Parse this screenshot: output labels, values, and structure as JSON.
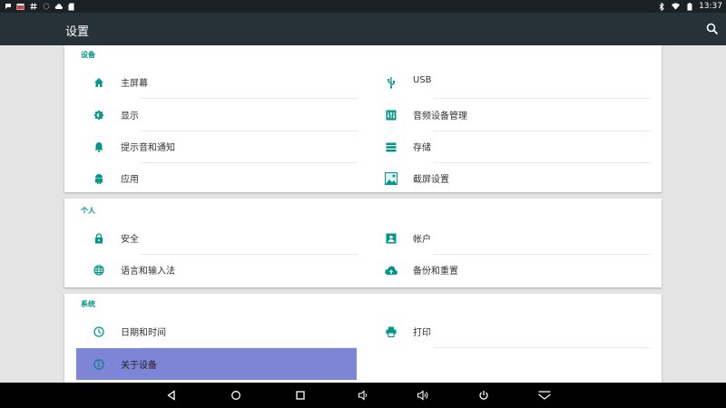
{
  "status_bar": {
    "time": "13:37",
    "left_icons": [
      "chat-bubble-icon",
      "calendar-icon",
      "hashtag-icon",
      "sync-icon",
      "cloud-icon",
      "sd-card-icon"
    ],
    "right_icons": [
      "bluetooth-icon",
      "wifi-icon",
      "battery-icon"
    ]
  },
  "action_bar": {
    "title": "设置",
    "search_icon": "search-icon"
  },
  "sections": [
    {
      "title": "设备",
      "items": [
        {
          "label": "主屏幕",
          "icon": "home-icon"
        },
        {
          "label": "USB",
          "icon": "usb-icon"
        },
        {
          "label": "显示",
          "icon": "brightness-icon"
        },
        {
          "label": "音频设备管理",
          "icon": "equalizer-icon"
        },
        {
          "label": "提示音和通知",
          "icon": "bell-icon"
        },
        {
          "label": "存储",
          "icon": "storage-icon"
        },
        {
          "label": "应用",
          "icon": "android-icon"
        },
        {
          "label": "截屏设置",
          "icon": "screenshot-image-icon"
        }
      ]
    },
    {
      "title": "个人",
      "items": [
        {
          "label": "安全",
          "icon": "lock-icon"
        },
        {
          "label": "帐户",
          "icon": "account-box-icon"
        },
        {
          "label": "语言和输入法",
          "icon": "globe-icon"
        },
        {
          "label": "备份和重置",
          "icon": "cloud-upload-icon"
        }
      ]
    },
    {
      "title": "系统",
      "items": [
        {
          "label": "日期和时间",
          "icon": "clock-icon"
        },
        {
          "label": "打印",
          "icon": "printer-icon"
        },
        {
          "label": "关于设备",
          "icon": "info-icon",
          "selected": true
        }
      ]
    }
  ],
  "nav_bar": [
    "back-icon",
    "home-circle-icon",
    "recents-icon",
    "volume-down-icon",
    "volume-up-icon",
    "power-icon",
    "collapse-icon"
  ],
  "colors": {
    "accent": "#009688",
    "action_bar": "#263238",
    "status_bar": "#1b2226",
    "selected_row": "#7e84d6",
    "background": "#e4e4e4"
  }
}
